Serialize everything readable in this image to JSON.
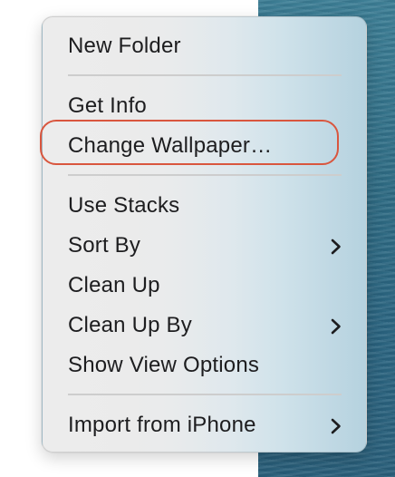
{
  "menu": {
    "items": [
      {
        "label": "New Folder",
        "submenu": false
      },
      {
        "label": "Get Info",
        "submenu": false
      },
      {
        "label": "Change Wallpaper…",
        "submenu": false
      },
      {
        "label": "Use Stacks",
        "submenu": false
      },
      {
        "label": "Sort By",
        "submenu": true
      },
      {
        "label": "Clean Up",
        "submenu": false
      },
      {
        "label": "Clean Up By",
        "submenu": true
      },
      {
        "label": "Show View Options",
        "submenu": false
      },
      {
        "label": "Import from iPhone",
        "submenu": true
      }
    ]
  },
  "highlight": {
    "target": "Change Wallpaper…",
    "color": "#d9563e"
  },
  "icons": {
    "submenu": "chevron-right-icon"
  },
  "colors": {
    "text": "#1d1d1f",
    "separator": "#cdcdcd",
    "wallpaper": "#2f6c84"
  }
}
